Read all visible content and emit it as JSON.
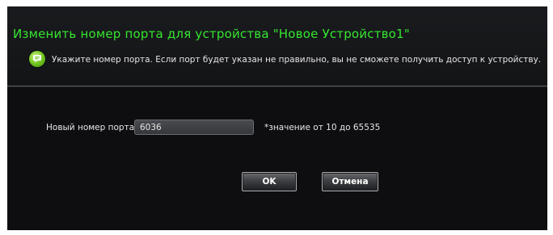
{
  "dialog": {
    "title": "Изменить номер порта для устройства \"Новое Устройство1\"",
    "info_text": "Укажите номер порта. Если порт будет указан не правильно, вы не сможете получить доступ к устройству.",
    "info_icon": "chat-bubble-icon"
  },
  "form": {
    "port_label": "Новый номер порта",
    "port_value": "6036",
    "hint": "*значение от 10 до 65535"
  },
  "buttons": {
    "ok_label": "OK",
    "cancel_label": "Отмена"
  },
  "colors": {
    "title": "#35e62f",
    "background": "#0e0e10",
    "icon_green": "#6cc21c"
  }
}
